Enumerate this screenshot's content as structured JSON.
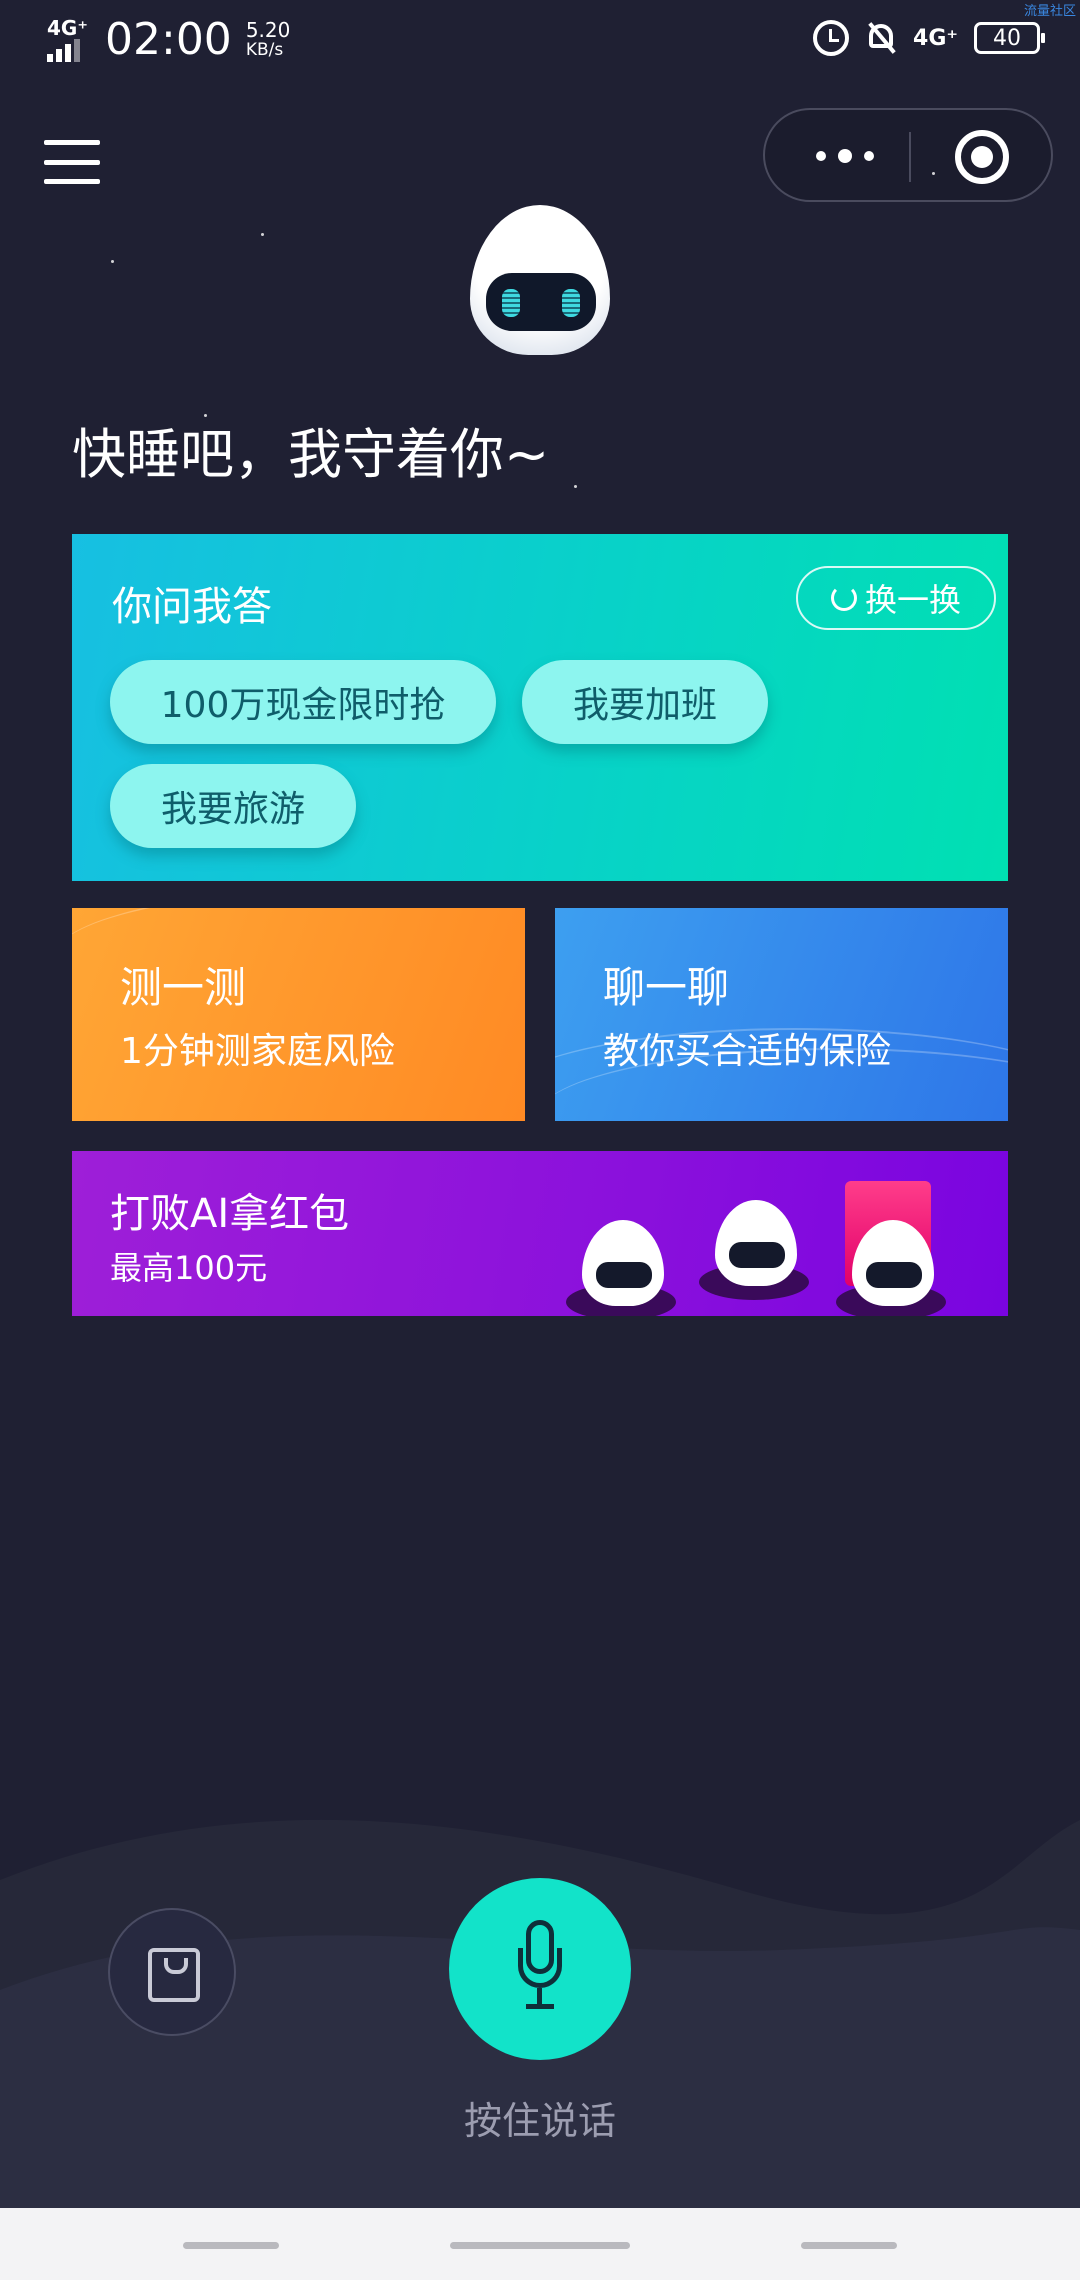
{
  "status_bar": {
    "network_left": "4G⁺",
    "time": "02:00",
    "speed_value": "5.20",
    "speed_unit": "KB/s",
    "network_right": "4G⁺",
    "battery": "40",
    "watermark": "流量社区"
  },
  "greeting": "快睡吧，我守着你~",
  "qa_card": {
    "title": "你问我答",
    "swap_label": "换一换",
    "chips": [
      "100万现金限时抢",
      "我要加班",
      "我要旅游"
    ]
  },
  "test_card": {
    "title": "测一测",
    "subtitle": "1分钟测家庭风险"
  },
  "chat_card": {
    "title": "聊一聊",
    "subtitle": "教你买合适的保险"
  },
  "banner": {
    "title": "打败AI拿红包",
    "subtitle": "最高100元"
  },
  "voice": {
    "hold_label": "按住说话"
  },
  "colors": {
    "background": "#1f2033",
    "accent": "#12e3c9",
    "qa_gradient_start": "#17bfe2",
    "qa_gradient_end": "#00e0b2",
    "test_card": "#ff9a2c",
    "chat_card": "#3389ec",
    "banner": "#8c12dc"
  },
  "icons": {
    "menu": "menu-icon",
    "more": "more-icon",
    "close_mini_program": "target-icon",
    "refresh": "refresh-icon",
    "shopping_bag": "shopping-bag-icon",
    "microphone": "microphone-icon"
  }
}
